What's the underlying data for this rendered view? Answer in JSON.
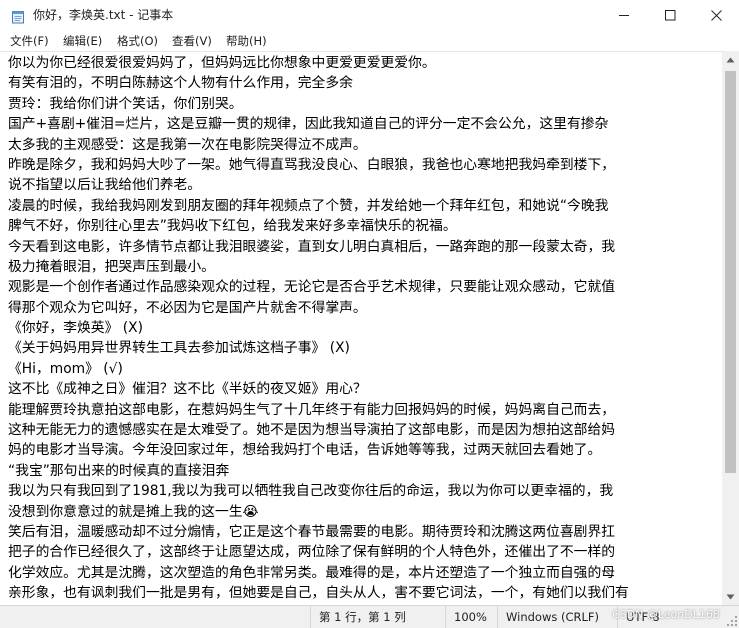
{
  "window": {
    "title": "你好，李焕英.txt - 记事本"
  },
  "menu": {
    "items": [
      "文件(F)",
      "编辑(E)",
      "格式(O)",
      "查看(V)",
      "帮助(H)"
    ]
  },
  "editor": {
    "lines": [
      "你以为你已经很爱很爱妈妈了，但妈妈远比你想象中更爱更爱更爱你。",
      "有笑有泪的，不明白陈赫这个人物有什么作用，完全多余",
      "贾玲：我给你们讲个笑话，你们别哭。",
      "国产+喜剧+催泪=烂片，这是豆瓣一贯的规律，因此我知道自己的评分一定不会公允，这里有掺杂",
      "太多我的主观感受：这是我第一次在电影院哭得泣不成声。",
      "昨晚是除夕，我和妈妈大吵了一架。她气得直骂我没良心、白眼狼，我爸也心寒地把我妈牵到楼下，",
      "说不指望以后让我给他们养老。",
      "凌晨的时候，我给我妈刚发到朋友圈的拜年视频点了个赞，并发给她一个拜年红包，和她说“今晚我",
      "脾气不好，你别往心里去”我妈收下红包，给我发来好多幸福快乐的祝福。",
      "今天看到这电影，许多情节点都让我泪眼婆娑，直到女儿明白真相后，一路奔跑的那一段蒙太奇，我",
      "极力掩着眼泪，把哭声压到最小。",
      "观影是一个创作者通过作品感染观众的过程，无论它是否合乎艺术规律，只要能让观众感动，它就值",
      "得那个观众为它叫好，不必因为它是国产片就舍不得掌声。",
      "《你好，李焕英》 (X)",
      "《关于妈妈用异世界转生工具去参加试炼这档子事》 (X)",
      "《Hi，mom》 (√)",
      "这不比《成神之日》催泪？这不比《半妖的夜叉姬》用心？",
      "能理解贾玲执意拍这部电影，在惹妈妈生气了十几年终于有能力回报妈妈的时候，妈妈离自己而去，",
      "这种无能无力的遗憾感实在是太难受了。她不是因为想当导演拍了这部电影，而是因为想拍这部给妈",
      "妈的电影才当导演。今年没回家过年，想给我妈打个电话，告诉她等等我，过两天就回去看她了。",
      "“我宝”那句出来的时候真的直接泪奔",
      "我以为只有我回到了1981,我以为我可以牺牲我自己改变你往后的命运，我以为你可以更幸福的，我",
      "没想到你意意过的就是摊上我的这一生😭",
      "笑后有泪，温暖感动却不过分煽情，它正是这个春节最需要的电影。期待贾玲和沈腾这两位喜剧界扛",
      "把子的合作已经很久了，这部终于让愿望达成，两位除了保有鲜明的个人特色外，还催出了不一样的",
      "化学效应。尤其是沈腾，这次塑造的角色非常另类。最难得的是，本片还塑造了一个独立而自强的母",
      "亲形象，也有讽刺我们一批是男有，但她要是自己，自头从人，害不要它词法，一个，有她们以我们有"
    ]
  },
  "status": {
    "position": "第 1 行，第 1 列",
    "zoom": "100%",
    "line_ending": "Windows (CRLF)",
    "encoding": "UTF-8"
  },
  "watermark": "CSDN @LeonDL168"
}
